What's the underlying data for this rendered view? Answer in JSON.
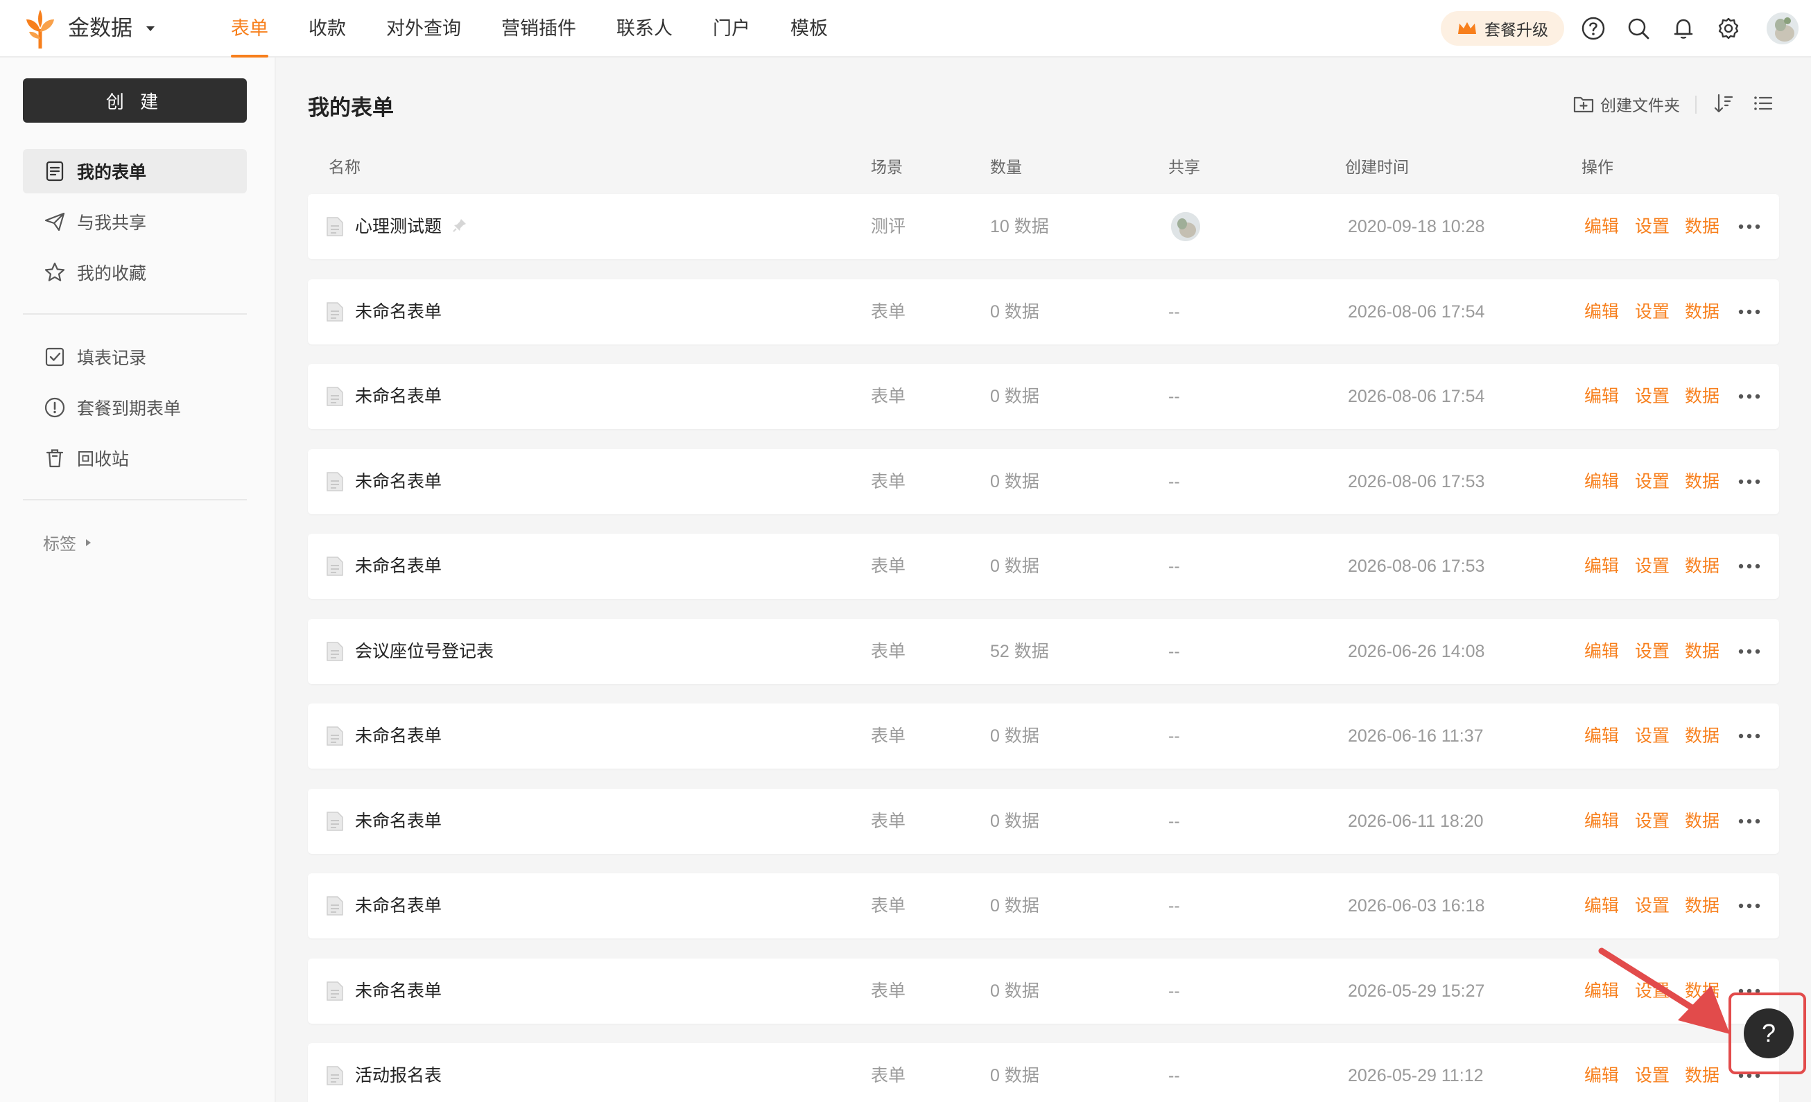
{
  "brand": {
    "name": "金数据"
  },
  "nav": [
    "表单",
    "收款",
    "对外查询",
    "营销插件",
    "联系人",
    "门户",
    "模板"
  ],
  "topbar": {
    "upgrade_label": "套餐升级"
  },
  "sidebar": {
    "create_label": "创 建",
    "items": [
      "我的表单",
      "与我共享",
      "我的收藏",
      "填表记录",
      "套餐到期表单",
      "回收站"
    ],
    "tags_label": "标签"
  },
  "main": {
    "title": "我的表单",
    "create_folder_label": "创建文件夹",
    "columns": [
      "名称",
      "场景",
      "数量",
      "共享",
      "创建时间",
      "操作"
    ],
    "actions": [
      "编辑",
      "设置",
      "数据"
    ],
    "rows": [
      {
        "name": "心理测试题",
        "scene": "测评",
        "count": "10 数据",
        "share": "",
        "created": "2020-09-18 10:28"
      },
      {
        "name": "未命名表单",
        "scene": "表单",
        "count": "0 数据",
        "share": "--",
        "created": "2026-08-06 17:54"
      },
      {
        "name": "未命名表单",
        "scene": "表单",
        "count": "0 数据",
        "share": "--",
        "created": "2026-08-06 17:54"
      },
      {
        "name": "未命名表单",
        "scene": "表单",
        "count": "0 数据",
        "share": "--",
        "created": "2026-08-06 17:53"
      },
      {
        "name": "未命名表单",
        "scene": "表单",
        "count": "0 数据",
        "share": "--",
        "created": "2026-08-06 17:53"
      },
      {
        "name": "会议座位号登记表",
        "scene": "表单",
        "count": "52 数据",
        "share": "--",
        "created": "2026-06-26 14:08"
      },
      {
        "name": "未命名表单",
        "scene": "表单",
        "count": "0 数据",
        "share": "--",
        "created": "2026-06-16 11:37"
      },
      {
        "name": "未命名表单",
        "scene": "表单",
        "count": "0 数据",
        "share": "--",
        "created": "2026-06-11 18:20"
      },
      {
        "name": "未命名表单",
        "scene": "表单",
        "count": "0 数据",
        "share": "--",
        "created": "2026-06-03 16:18"
      },
      {
        "name": "未命名表单",
        "scene": "表单",
        "count": "0 数据",
        "share": "--",
        "created": "2026-05-29 15:27"
      },
      {
        "name": "活动报名表",
        "scene": "表单",
        "count": "0 数据",
        "share": "--",
        "created": "2026-05-29 11:12"
      }
    ]
  },
  "help": {
    "label": "?"
  },
  "colors": {
    "accent": "#f77f1c",
    "dark": "#2f2f2f",
    "highlight": "#e24b4b"
  }
}
